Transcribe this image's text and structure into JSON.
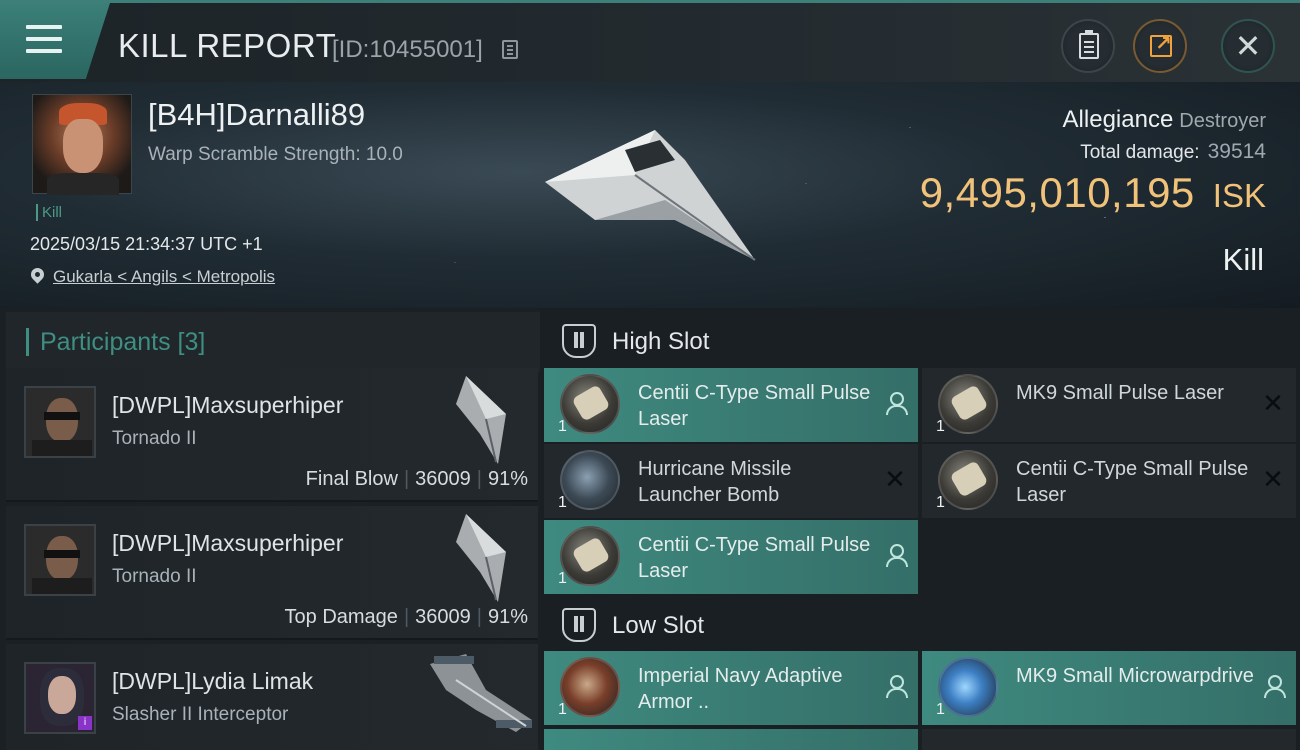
{
  "header": {
    "title": "KILL REPORT",
    "report_id": "[ID:10455001]",
    "icons": {
      "menu": "menu-icon",
      "copy": "copy-icon",
      "clipboard": "clipboard-icon",
      "share": "share-icon",
      "close": "close-icon"
    },
    "close_glyph": "✕"
  },
  "victim": {
    "name": "[B4H]Darnalli89",
    "scramble": "Warp Scramble Strength: 10.0",
    "tag": "Kill",
    "timestamp": "2025/03/15 21:34:37 UTC +1",
    "location": "Gukarla < Angils < Metropolis",
    "allegiance_label": "Allegiance",
    "allegiance_value": "Destroyer",
    "total_damage_label": "Total damage:",
    "total_damage_value": "39514",
    "isk_amount": "9,495,010,195",
    "isk_unit": "ISK",
    "kill_type": "Kill"
  },
  "participants": {
    "header": "Participants [3]",
    "rows": [
      {
        "name": "[DWPL]Maxsuperhiper",
        "ship": "Tornado II",
        "role": "Final Blow",
        "damage": "36009",
        "percent": "91%"
      },
      {
        "name": "[DWPL]Maxsuperhiper",
        "ship": "Tornado II",
        "role": "Top Damage",
        "damage": "36009",
        "percent": "91%"
      },
      {
        "name": "[DWPL]Lydia Limak",
        "ship": "Slasher II Interceptor",
        "role": "",
        "damage": "",
        "percent": ""
      }
    ]
  },
  "fitting": {
    "high_slot": {
      "title": "High Slot",
      "modules": [
        {
          "name": "Centii C-Type Small Pulse Laser",
          "qty": "1",
          "status": "dropped"
        },
        {
          "name": "MK9 Small Pulse Laser",
          "qty": "1",
          "status": "destroyed"
        },
        {
          "name": "Hurricane Missile Launcher Bomb",
          "qty": "1",
          "status": "destroyed"
        },
        {
          "name": "Centii C-Type Small Pulse Laser",
          "qty": "1",
          "status": "destroyed"
        },
        {
          "name": "Centii C-Type Small Pulse Laser",
          "qty": "1",
          "status": "dropped"
        }
      ]
    },
    "low_slot": {
      "title": "Low Slot",
      "modules": [
        {
          "name": "Imperial Navy Adaptive Armor ..",
          "qty": "1",
          "status": "dropped"
        },
        {
          "name": "MK9 Small Microwarpdrive",
          "qty": "1",
          "status": "dropped"
        }
      ]
    },
    "destroyed_glyph": "✕"
  },
  "colors": {
    "accent": "#3f8a80",
    "isk": "#f1c27a",
    "header_bar": "#3f7f79"
  }
}
